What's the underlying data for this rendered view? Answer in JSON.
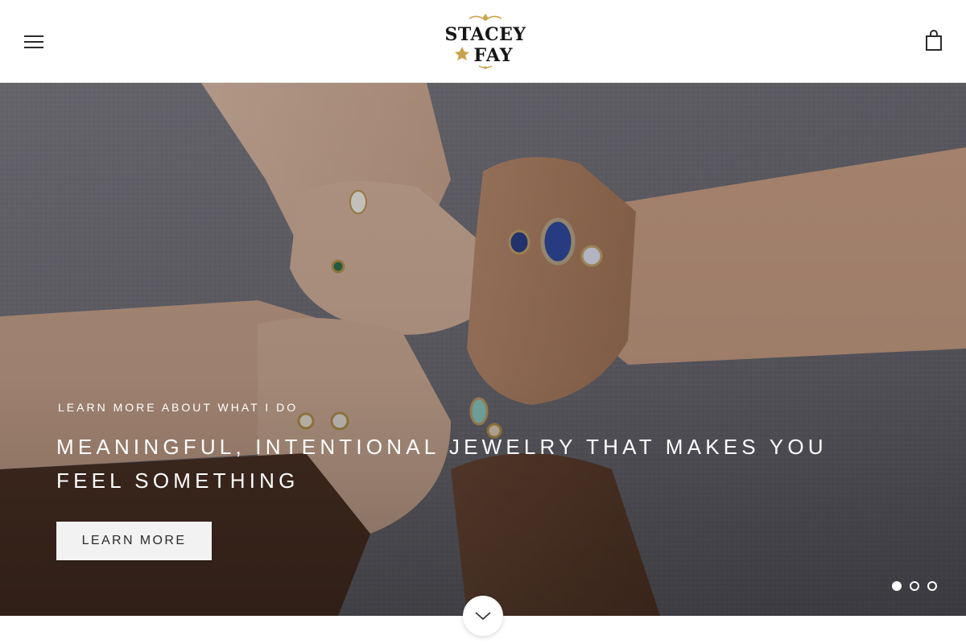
{
  "header": {
    "menu_icon": "hamburger-menu-icon",
    "logo_alt": "Stacey Fay",
    "logo_line1": "STACEY",
    "logo_line2": "FAY",
    "cart_icon": "shopping-bag-icon"
  },
  "hero": {
    "eyebrow": "LEARN MORE ABOUT WHAT I DO",
    "title": "MEANINGFUL, INTENTIONAL JEWELRY THAT MAKES YOU FEEL SOMETHING",
    "button_label": "LEARN MORE",
    "slides": {
      "count": 3,
      "active_index": 0
    },
    "scroll_icon": "chevron-down-icon"
  },
  "colors": {
    "header_bg": "#ffffff",
    "button_bg": "#f2f2f2",
    "button_text": "#2b2b2b",
    "hero_text": "#ffffff"
  }
}
